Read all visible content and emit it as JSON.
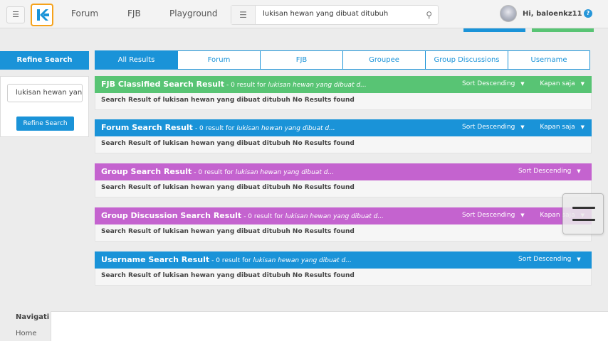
{
  "header": {
    "nav": [
      "Forum",
      "FJB",
      "Playground"
    ],
    "search_value": "lukisan hewan yang dibuat ditubuh",
    "greeting": "Hi, baloenkz11",
    "help_label": "?"
  },
  "sidebar": {
    "title": "Refine Search",
    "input_value": "lukisan hewan yang dibuat ditubuh",
    "button_label": "Refine Search"
  },
  "tabs": [
    {
      "label": "All Results",
      "active": true
    },
    {
      "label": "Forum",
      "active": false
    },
    {
      "label": "FJB",
      "active": false
    },
    {
      "label": "Groupee",
      "active": false
    },
    {
      "label": "Group Discussions",
      "active": false
    },
    {
      "label": "Username",
      "active": false
    }
  ],
  "sections": [
    {
      "title": "FJB Classified Search Result",
      "count": "- 0 result for",
      "query": "lukisan hewan yang dibuat d...",
      "sort": "Sort Descending",
      "time": "Kapan saja",
      "body": "Search Result of lukisan hewan yang dibuat ditubuh No Results found",
      "color": "#58c474"
    },
    {
      "title": "Forum Search Result",
      "count": "- 0 result for",
      "query": "lukisan hewan yang dibuat d...",
      "sort": "Sort Descending",
      "time": "Kapan saja",
      "body": "Search Result of lukisan hewan yang dibuat ditubuh No Results found",
      "color": "#1a93d8"
    },
    {
      "title": "Group Search Result",
      "count": "- 0 result for",
      "query": "lukisan hewan yang dibuat d...",
      "sort": "Sort Descending",
      "time": "",
      "body": "Search Result of lukisan hewan yang dibuat ditubuh No Results found",
      "color": "#c463cf"
    },
    {
      "title": "Group Discussion Search Result",
      "count": "- 0 result for",
      "query": "lukisan hewan yang dibuat d...",
      "sort": "Sort Descending",
      "time": "Kapan saja",
      "body": "Search Result of lukisan hewan yang dibuat ditubuh No Results found",
      "color": "#c463cf"
    },
    {
      "title": "Username Search Result",
      "count": "- 0 result for",
      "query": "lukisan hewan yang dibuat d...",
      "sort": "Sort Descending",
      "time": "",
      "body": "Search Result of lukisan hewan yang dibuat ditubuh No Results found",
      "color": "#1a93d8"
    }
  ],
  "footer": {
    "nav_label": "Navigati",
    "home_label": "Home"
  }
}
